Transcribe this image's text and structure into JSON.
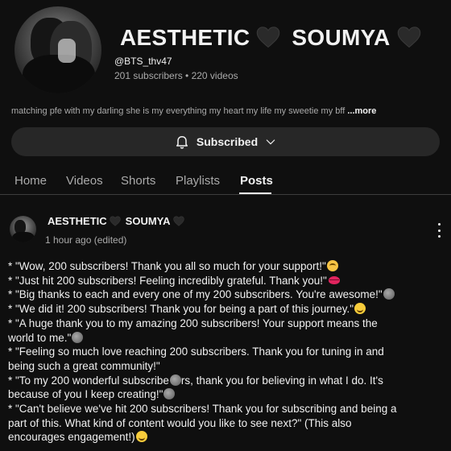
{
  "channel": {
    "name_part1": "AESTHETIC",
    "name_part2": "SOUMYA",
    "handle": "@BTS_thv47",
    "stats": "201 subscribers • 220 videos",
    "description": "matching pfe with my darling she is my everything my heart my life my sweetie my bff ",
    "more_label": "...more",
    "avatar_icon": "channel-avatar-photo",
    "heart_icon": "black-heart-icon"
  },
  "subscribe": {
    "label": "Subscribed",
    "bell_icon": "bell-icon",
    "chevron_icon": "chevron-down-icon"
  },
  "tabs": [
    "Home",
    "Videos",
    "Shorts",
    "Playlists",
    "Posts"
  ],
  "active_tab": "Posts",
  "post": {
    "author_part1": "AESTHETIC",
    "author_part2": "SOUMYA",
    "time": "1 hour ago (edited)",
    "lines": [
      "* \"Wow, 200 subscribers! Thank you all so much for your support!\"",
      " * \"Just hit 200 subscribers! Feeling incredibly grateful. Thank you!\"",
      " * \"Big thanks to each and every one of my 200 subscribers. You're awesome!\"",
      " * \"We did it! 200 subscribers! Thank you for being a part of this journey.\"",
      " * \"A huge thank you to my amazing 200 subscribers! Your support means the",
      "world to me.\"",
      " * \"Feeling so much love reaching 200 subscribers. Thank you for tuning in and",
      "being such a great community!\"",
      " * \"To my 200 wonderful subscribe",
      "rs, thank you for believing in what I do. It's",
      "because of you I keep creating!\"",
      " * \"Can't believe we've hit 200 subscribers! Thank you for subscribing and being a",
      "part of this. What kind of content would you like to see next?\" (This also",
      "encourages engagement!)"
    ],
    "emoji_icons": [
      "pleading-face-emoji",
      "kiss-lips-emoji",
      "moon-emoji",
      "smile-emoji",
      "moon-emoji",
      "moon-emoji",
      "moon-emoji",
      "grin-emoji"
    ],
    "menu_icon": "more-vert-icon"
  },
  "colors": {
    "background": "#0f0f0f",
    "text": "#f1f1f1",
    "secondary_text": "#aaaaaa",
    "button_bg": "#272727"
  }
}
